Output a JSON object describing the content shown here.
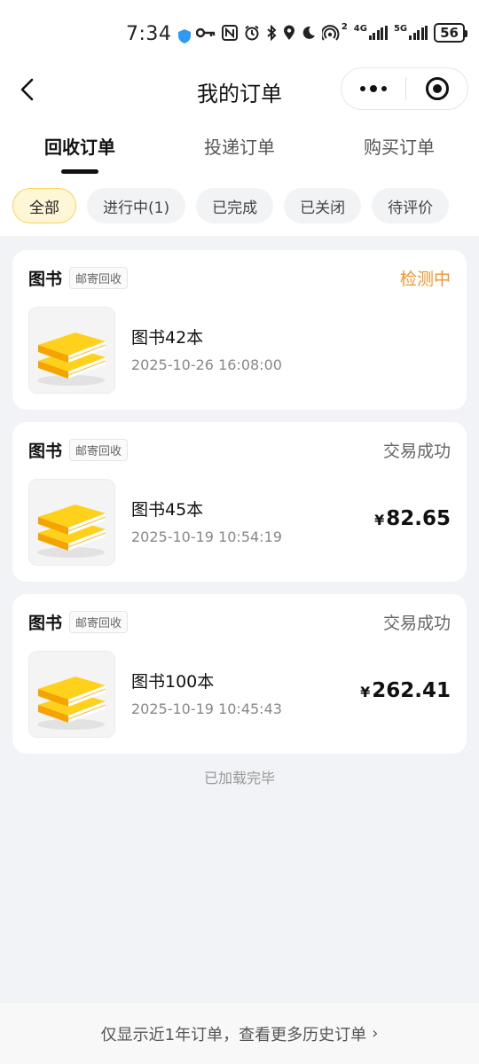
{
  "status_bar": {
    "time": "7:34",
    "network_4g": "4G",
    "network_5g": "5G",
    "sim_index": "2",
    "battery": "56"
  },
  "header": {
    "title": "我的订单"
  },
  "tabs": [
    {
      "label": "回收订单",
      "active": true
    },
    {
      "label": "投递订单",
      "active": false
    },
    {
      "label": "购买订单",
      "active": false
    }
  ],
  "filters": [
    {
      "label": "全部",
      "active": true
    },
    {
      "label": "进行中(1)",
      "active": false
    },
    {
      "label": "已完成",
      "active": false
    },
    {
      "label": "已关闭",
      "active": false
    },
    {
      "label": "待评价",
      "active": false
    }
  ],
  "orders": [
    {
      "category": "图书",
      "tag": "邮寄回收",
      "status": "检测中",
      "status_color": "#f0932b",
      "name": "图书42本",
      "time": "2025-10-26 16:08:00",
      "currency": "",
      "price": ""
    },
    {
      "category": "图书",
      "tag": "邮寄回收",
      "status": "交易成功",
      "status_color": "#666666",
      "name": "图书45本",
      "time": "2025-10-19 10:54:19",
      "currency": "¥",
      "price": "82.65"
    },
    {
      "category": "图书",
      "tag": "邮寄回收",
      "status": "交易成功",
      "status_color": "#666666",
      "name": "图书100本",
      "time": "2025-10-19 10:45:43",
      "currency": "¥",
      "price": "262.41"
    }
  ],
  "list_end_text": "已加载完毕",
  "footer": {
    "text": "仅显示近1年订单，查看更多历史订单",
    "chevron": "›"
  },
  "colors": {
    "accent_yellow": "#f6d55c",
    "status_orange": "#f0932b",
    "background": "#f2f3f7"
  }
}
